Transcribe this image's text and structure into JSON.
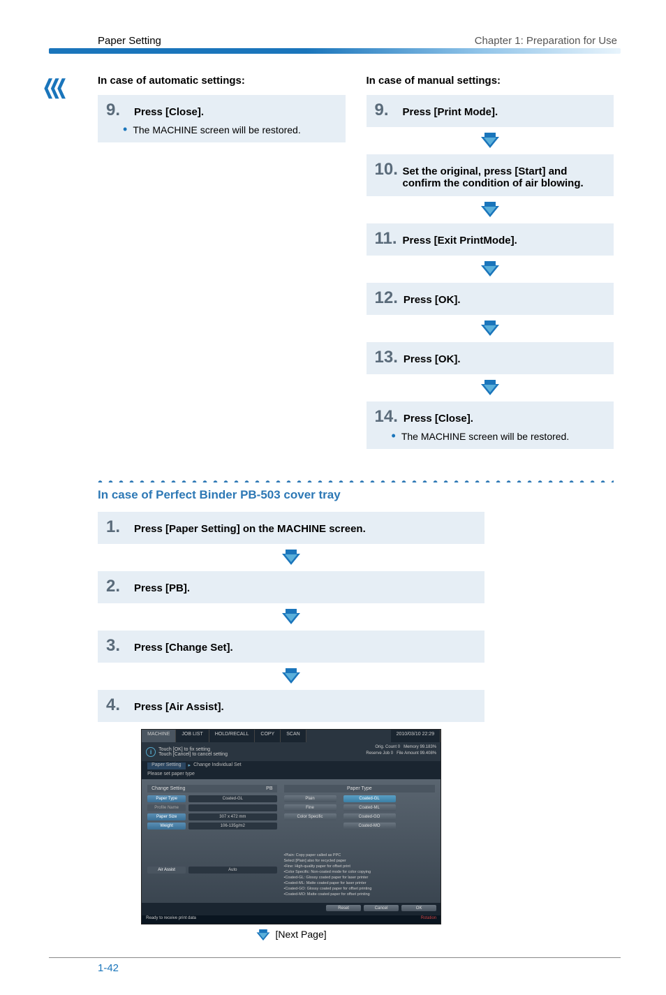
{
  "header": {
    "left": "Paper Setting",
    "right": "Chapter 1: Preparation for Use"
  },
  "col_auto": {
    "heading": "In case of automatic settings:",
    "step9": {
      "num": "9.",
      "text": "Press [Close]."
    },
    "step9_bullet": "The MACHINE screen will be restored."
  },
  "col_manual": {
    "heading": "In case of manual settings:",
    "step9": {
      "num": "9.",
      "text": "Press [Print Mode]."
    },
    "step10": {
      "num": "10.",
      "text": "Set the original, press [Start] and confirm the condition of air blowing."
    },
    "step11": {
      "num": "11.",
      "text": "Press [Exit PrintMode]."
    },
    "step12": {
      "num": "12.",
      "text": "Press [OK]."
    },
    "step13": {
      "num": "13.",
      "text": "Press [OK]."
    },
    "step14": {
      "num": "14.",
      "text": "Press [Close]."
    },
    "step14_bullet": "The MACHINE screen will be restored."
  },
  "section2": {
    "heading": "In case of Perfect Binder PB-503 cover tray",
    "step1": {
      "num": "1.",
      "text": "Press [Paper Setting] on the MACHINE screen."
    },
    "step2": {
      "num": "2.",
      "text": "Press [PB]."
    },
    "step3": {
      "num": "3.",
      "text": "Press [Change Set]."
    },
    "step4": {
      "num": "4.",
      "text": "Press [Air Assist]."
    }
  },
  "screenshot": {
    "tabs": [
      "MACHINE",
      "JOB LIST",
      "HOLD/RECALL",
      "COPY",
      "SCAN"
    ],
    "timestamp": "2010/03/10 22:29",
    "info_l1": "Touch [OK] to fix setting",
    "info_l2": "Touch [Cancel] to cancel setting",
    "info_r1_label": "Orig. Count",
    "info_r1_val": "0",
    "info_r2_label": "Memory",
    "info_r2_val": "99.183%",
    "info_r3_label": "Reserve Job",
    "info_r3_val": "0",
    "info_r4_label": "File Amount",
    "info_r4_val": "99.408%",
    "crumb1": "Paper Setting",
    "crumb2": "Change Individual Set",
    "subhead": "Please set paper type",
    "left_head": "Change Setting",
    "left_head_r": "PB",
    "row1_lbl": "Paper Type",
    "row1_val": "Coated-GL",
    "row2_lbl": "Profile Name",
    "row3_lbl": "Paper Size",
    "row3_val": "307 x  472 mm",
    "row4_lbl": "Weight",
    "row4_val": "106-135g/m2",
    "air_lbl": "Air Assist",
    "air_val": "Auto",
    "right_head": "Paper Type",
    "opt_plain": "Plain",
    "opt_gl": "Coated-GL",
    "opt_fine": "Fine",
    "opt_ml": "Coated-ML",
    "opt_color": "Color Specific",
    "opt_go": "Coated-GO",
    "opt_mo": "Coated-MO",
    "desc": "•Plain: Copy paper called as PPC\n Select [Plain] also for recycled paper\n•Fine: High-quality paper for offset print\n•Color Specific: Non-coated mode for color copying\n•Coated-GL: Glossy coated paper for laser printer\n•Coated-ML: Matte coated paper for laser printer\n•Coated-GO: Glossy coated paper for offset printing\n•Coated-MO: Matte coated paper for offset printing",
    "btn_reset": "Reset",
    "btn_cancel": "Cancel",
    "btn_ok": "OK",
    "status_l": "Ready to receive print data",
    "status_r": "Rotation"
  },
  "next_page": "[Next Page]",
  "page_number": "1-42"
}
